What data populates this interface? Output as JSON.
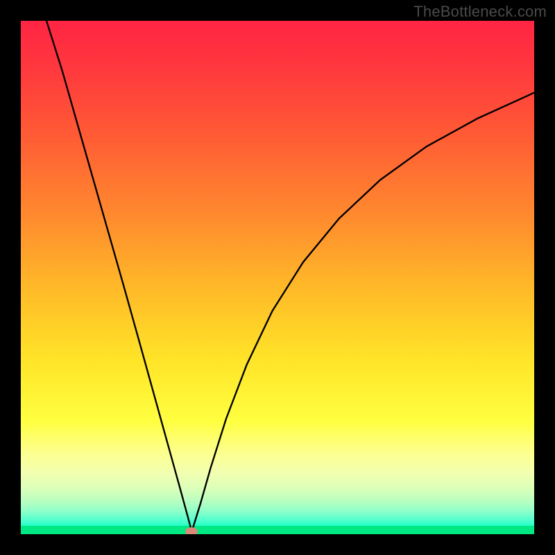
{
  "watermark": "TheBottleneck.com",
  "colors": {
    "frame": "#000000",
    "gradient_top": "#ff2444",
    "gradient_bottom": "#00e884",
    "curve": "#000000",
    "dot": "#d98a78"
  },
  "chart_data": {
    "type": "line",
    "title": "",
    "xlabel": "",
    "ylabel": "",
    "xlim": [
      0,
      1
    ],
    "ylim": [
      0,
      1
    ],
    "annotations": [
      "TheBottleneck.com"
    ],
    "description": "V-shaped bottleneck curve over vertical red-to-green gradient background. Minimum near x≈0.33, y≈0. Left branch steep from top-left corner; right branch concave rising toward upper right. Pink marker at the minimum.",
    "minimum": {
      "x": 0.333,
      "y": 0.005
    },
    "series": [
      {
        "name": "left-branch",
        "x": [
          0.05,
          0.08,
          0.11,
          0.14,
          0.17,
          0.2,
          0.23,
          0.26,
          0.29,
          0.31,
          0.325,
          0.333
        ],
        "y": [
          1.0,
          0.905,
          0.8,
          0.695,
          0.59,
          0.485,
          0.378,
          0.27,
          0.162,
          0.09,
          0.035,
          0.005
        ]
      },
      {
        "name": "right-branch",
        "x": [
          0.333,
          0.35,
          0.37,
          0.4,
          0.44,
          0.49,
          0.55,
          0.62,
          0.7,
          0.79,
          0.89,
          1.0
        ],
        "y": [
          0.005,
          0.06,
          0.13,
          0.225,
          0.33,
          0.435,
          0.53,
          0.615,
          0.69,
          0.755,
          0.81,
          0.86
        ]
      }
    ]
  }
}
